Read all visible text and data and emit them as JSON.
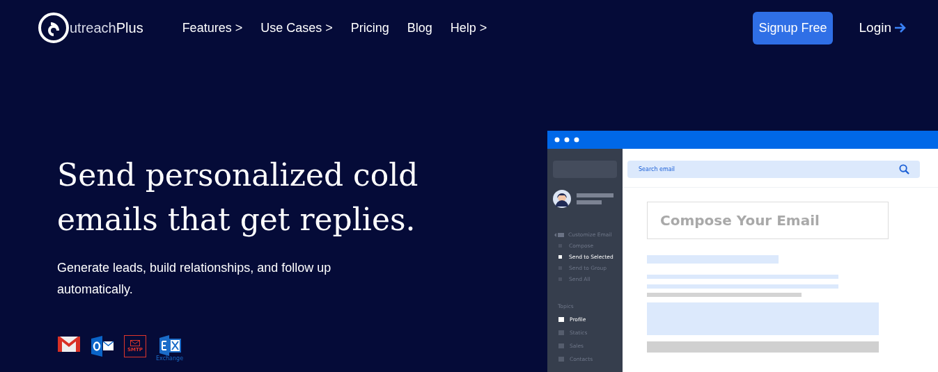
{
  "header": {
    "logo": {
      "letter_part": "utreach",
      "bold_part": "Plus"
    },
    "nav": [
      {
        "label": "Features >"
      },
      {
        "label": "Use Cases >"
      },
      {
        "label": "Pricing"
      },
      {
        "label": "Blog"
      },
      {
        "label": "Help >"
      }
    ],
    "signup": "Signup Free",
    "login": "Login"
  },
  "hero": {
    "heading": "Send personalized cold emails that get replies.",
    "subtitle": "Generate leads, build relationships, and follow up automatically.",
    "integrations": [
      {
        "kind": "gmail"
      },
      {
        "kind": "outlook"
      },
      {
        "kind": "smtp",
        "label": "SMTP"
      },
      {
        "kind": "exchange",
        "label": "Exchange"
      }
    ]
  },
  "mockup": {
    "search": {
      "placeholder": "Search email"
    },
    "menu": {
      "label": "Customize Email",
      "items": [
        {
          "label": "Compose",
          "selected": false
        },
        {
          "label": "Send to Selected",
          "selected": true
        },
        {
          "label": "Send to Group",
          "selected": false
        },
        {
          "label": "Send All",
          "selected": false
        }
      ]
    },
    "topics_label": "Topics",
    "topics": [
      {
        "label": "Profile",
        "selected": true
      },
      {
        "label": "Statics",
        "selected": false
      },
      {
        "label": "Sales",
        "selected": false
      },
      {
        "label": "Contacts",
        "selected": false
      }
    ],
    "compose_title": "Compose Your Email"
  }
}
